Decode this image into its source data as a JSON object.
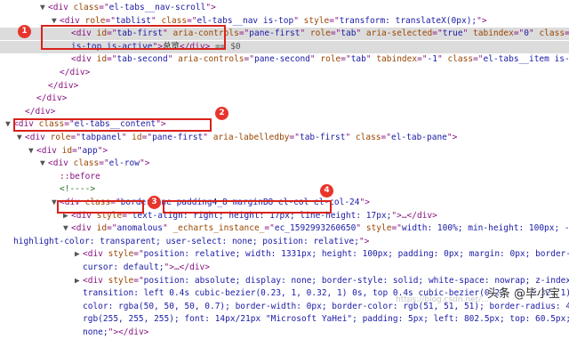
{
  "lines": [
    {
      "indent": 3,
      "tw": "▼",
      "parts": [
        [
          "tag",
          "<div "
        ],
        [
          "an",
          "class"
        ],
        [
          "tag",
          "=\""
        ],
        [
          "av",
          "el-tabs__nav-scroll"
        ],
        [
          "tag",
          "\">"
        ]
      ]
    },
    {
      "indent": 4,
      "tw": "▼",
      "parts": [
        [
          "tag",
          "<div "
        ],
        [
          "an",
          "role"
        ],
        [
          "tag",
          "=\""
        ],
        [
          "av",
          "tablist"
        ],
        [
          "tag",
          "\" "
        ],
        [
          "an",
          "class"
        ],
        [
          "tag",
          "=\""
        ],
        [
          "av",
          "el-tabs__nav is-top"
        ],
        [
          "tag",
          "\" "
        ],
        [
          "an",
          "style"
        ],
        [
          "tag",
          "=\""
        ],
        [
          "av",
          "transform: translateX(0px);"
        ],
        [
          "tag",
          "\">"
        ]
      ]
    },
    {
      "indent": 5,
      "tw": "",
      "hl": true,
      "parts": [
        [
          "tag",
          "<div "
        ],
        [
          "an",
          "id"
        ],
        [
          "tag",
          "=\""
        ],
        [
          "av",
          "tab-first"
        ],
        [
          "tag",
          "\" "
        ],
        [
          "an",
          "aria-controls"
        ],
        [
          "tag",
          "=\""
        ],
        [
          "av",
          "pane-first"
        ],
        [
          "tag",
          "\" "
        ],
        [
          "an",
          "role"
        ],
        [
          "tag",
          "=\""
        ],
        [
          "av",
          "tab"
        ],
        [
          "tag",
          "\" "
        ],
        [
          "an",
          "aria-selected"
        ],
        [
          "tag",
          "=\""
        ],
        [
          "av",
          "true"
        ],
        [
          "tag",
          "\" "
        ],
        [
          "an",
          "tabindex"
        ],
        [
          "tag",
          "=\""
        ],
        [
          "av",
          "0"
        ],
        [
          "tag",
          "\" "
        ],
        [
          "an",
          "class"
        ],
        [
          "tag",
          "=\""
        ],
        [
          "av",
          "el-tabs__i"
        ]
      ]
    },
    {
      "indent": 5,
      "tw": "",
      "hl": true,
      "parts": [
        [
          "av",
          "is-top is-active"
        ],
        [
          "tag",
          "\">"
        ],
        [
          "txt",
          "总览"
        ],
        [
          "tag",
          "</div>"
        ],
        [
          "ref",
          " == $0"
        ]
      ]
    },
    {
      "indent": 5,
      "tw": "",
      "parts": [
        [
          "tag",
          "<div "
        ],
        [
          "an",
          "id"
        ],
        [
          "tag",
          "=\""
        ],
        [
          "av",
          "tab-second"
        ],
        [
          "tag",
          "\" "
        ],
        [
          "an",
          "aria-controls"
        ],
        [
          "tag",
          "=\""
        ],
        [
          "av",
          "pane-second"
        ],
        [
          "tag",
          "\" "
        ],
        [
          "an",
          "role"
        ],
        [
          "tag",
          "=\""
        ],
        [
          "av",
          "tab"
        ],
        [
          "tag",
          "\" "
        ],
        [
          "an",
          "tabindex"
        ],
        [
          "tag",
          "=\""
        ],
        [
          "av",
          "-1"
        ],
        [
          "tag",
          "\" "
        ],
        [
          "an",
          "class"
        ],
        [
          "tag",
          "=\""
        ],
        [
          "av",
          "el-tabs__item is-top"
        ],
        [
          "tag",
          "\">"
        ],
        [
          "txt",
          "攻击IP"
        ]
      ]
    },
    {
      "indent": 4,
      "tw": "",
      "parts": [
        [
          "tag",
          "</div>"
        ]
      ]
    },
    {
      "indent": 3,
      "tw": "",
      "parts": [
        [
          "tag",
          "</div>"
        ]
      ]
    },
    {
      "indent": 2,
      "tw": "",
      "parts": [
        [
          "tag",
          "</div>"
        ]
      ]
    },
    {
      "indent": 1,
      "tw": "",
      "parts": [
        [
          "tag",
          "</div>"
        ]
      ]
    },
    {
      "indent": 0,
      "tw": "▼",
      "parts": [
        [
          "tag",
          "<div "
        ],
        [
          "an",
          "class"
        ],
        [
          "tag",
          "=\""
        ],
        [
          "av",
          "el-tabs__content"
        ],
        [
          "tag",
          "\">"
        ]
      ]
    },
    {
      "indent": 1,
      "tw": "▼",
      "parts": [
        [
          "tag",
          "<div "
        ],
        [
          "an",
          "role"
        ],
        [
          "tag",
          "=\""
        ],
        [
          "av",
          "tabpanel"
        ],
        [
          "tag",
          "\" "
        ],
        [
          "an",
          "id"
        ],
        [
          "tag",
          "=\""
        ],
        [
          "av",
          "pane-first"
        ],
        [
          "tag",
          "\" "
        ],
        [
          "an",
          "aria-labelledby"
        ],
        [
          "tag",
          "=\""
        ],
        [
          "av",
          "tab-first"
        ],
        [
          "tag",
          "\" "
        ],
        [
          "an",
          "class"
        ],
        [
          "tag",
          "=\""
        ],
        [
          "av",
          "el-tab-pane"
        ],
        [
          "tag",
          "\">"
        ]
      ]
    },
    {
      "indent": 2,
      "tw": "▼",
      "parts": [
        [
          "tag",
          "<div "
        ],
        [
          "an",
          "id"
        ],
        [
          "tag",
          "=\""
        ],
        [
          "av",
          "app"
        ],
        [
          "tag",
          "\">"
        ]
      ]
    },
    {
      "indent": 3,
      "tw": "▼",
      "parts": [
        [
          "tag",
          "<div "
        ],
        [
          "an",
          "class"
        ],
        [
          "tag",
          "=\""
        ],
        [
          "av",
          "el-row"
        ],
        [
          "tag",
          "\">"
        ]
      ]
    },
    {
      "indent": 4,
      "tw": "",
      "parts": [
        [
          "pseudo",
          "::before"
        ]
      ]
    },
    {
      "indent": 4,
      "tw": "",
      "parts": [
        [
          "cmt",
          "<!---->"
        ]
      ]
    },
    {
      "indent": 4,
      "tw": "▼",
      "parts": [
        [
          "tag",
          "<div "
        ],
        [
          "an",
          "class"
        ],
        [
          "tag",
          "=\""
        ],
        [
          "av",
          "borderLine padding4_8 marginB8 el-col el-col-24"
        ],
        [
          "tag",
          "\">"
        ]
      ]
    },
    {
      "indent": 5,
      "tw": "▶",
      "parts": [
        [
          "tag",
          "<div "
        ],
        [
          "an",
          "style"
        ],
        [
          "tag",
          "=\""
        ],
        [
          "av",
          "text-align: right; height: 17px; line-height: 17px;"
        ],
        [
          "tag",
          "\">…</div>"
        ]
      ]
    },
    {
      "indent": 5,
      "tw": "▼",
      "parts": [
        [
          "tag",
          "<div "
        ],
        [
          "an",
          "id"
        ],
        [
          "tag",
          "=\""
        ],
        [
          "av",
          "anomalous"
        ],
        [
          "tag",
          "\" "
        ],
        [
          "an",
          "_echarts_instance_"
        ],
        [
          "tag",
          "=\""
        ],
        [
          "av",
          "ec_1592993260650"
        ],
        [
          "tag",
          "\" "
        ],
        [
          "an",
          "style"
        ],
        [
          "tag",
          "=\""
        ],
        [
          "av",
          "width: 100%; min-height: 100px; -webkit-ta"
        ]
      ]
    },
    {
      "indent": 0,
      "tw": "",
      "parts": [
        [
          "av",
          "highlight-color: transparent; user-select: none; position: relative;"
        ],
        [
          "tag",
          "\">"
        ]
      ]
    },
    {
      "indent": 6,
      "tw": "▶",
      "parts": [
        [
          "tag",
          "<div "
        ],
        [
          "an",
          "style"
        ],
        [
          "tag",
          "=\""
        ],
        [
          "av",
          "position: relative; width: 1331px; height: 100px; padding: 0px; margin: 0px; border-width: 0p"
        ]
      ]
    },
    {
      "indent": 6,
      "tw": "",
      "parts": [
        [
          "av",
          "cursor: default;"
        ],
        [
          "tag",
          "\">…</div>"
        ]
      ]
    },
    {
      "indent": 6,
      "tw": "▶",
      "parts": [
        [
          "tag",
          "<div "
        ],
        [
          "an",
          "style"
        ],
        [
          "tag",
          "=\""
        ],
        [
          "av",
          "position: absolute; display: none; border-style: solid; white-space: nowrap; z-index: 9999999"
        ]
      ]
    },
    {
      "indent": 6,
      "tw": "",
      "parts": [
        [
          "av",
          "transition: left 0.4s cubic-bezier(0.23, 1, 0.32, 1) 0s, top 0.4s cubic-bezier(0.23, 1, 0.32, 1) 0s; backgr"
        ]
      ]
    },
    {
      "indent": 6,
      "tw": "",
      "parts": [
        [
          "av",
          "color: rgba(50, 50, 50, 0.7); border-width: 0px; border-color: rgb(51, 51, 51); border-radius: 4px; color:"
        ]
      ]
    },
    {
      "indent": 6,
      "tw": "",
      "parts": [
        [
          "av",
          "rgb(255, 255, 255); font: 14px/21px \"Microsoft YaHei\"; padding: 5px; left: 802.5px; top: 60.5px; pointer-ev"
        ]
      ]
    },
    {
      "indent": 6,
      "tw": "",
      "parts": [
        [
          "av",
          "none;"
        ],
        [
          "tag",
          "\">"
        ],
        [
          "tag",
          "</div>"
        ]
      ]
    }
  ],
  "badges": [
    "1",
    "2",
    "3",
    "4"
  ],
  "watermark": "头条 @毕小宝",
  "watermark_faint": "https://blog.csdn.net/..."
}
